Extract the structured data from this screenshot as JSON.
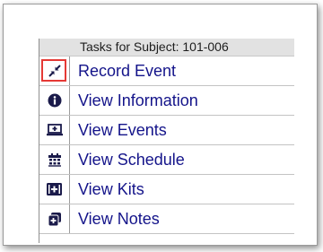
{
  "menu": {
    "header": "Tasks for Subject: 101-006",
    "items": [
      {
        "label": "Record Event",
        "icon": "compress-arrows-icon",
        "highlighted": true
      },
      {
        "label": "View Information",
        "icon": "info-circle-icon"
      },
      {
        "label": "View Events",
        "icon": "monitor-plus-icon"
      },
      {
        "label": "View Schedule",
        "icon": "calendar-icon"
      },
      {
        "label": "View Kits",
        "icon": "kit-box-icon"
      },
      {
        "label": "View Notes",
        "icon": "notes-icon"
      }
    ]
  },
  "colors": {
    "label": "#14148a",
    "icon": "#1a1a4a",
    "highlight": "#e53935",
    "header_bg": "#e2e2e2"
  }
}
